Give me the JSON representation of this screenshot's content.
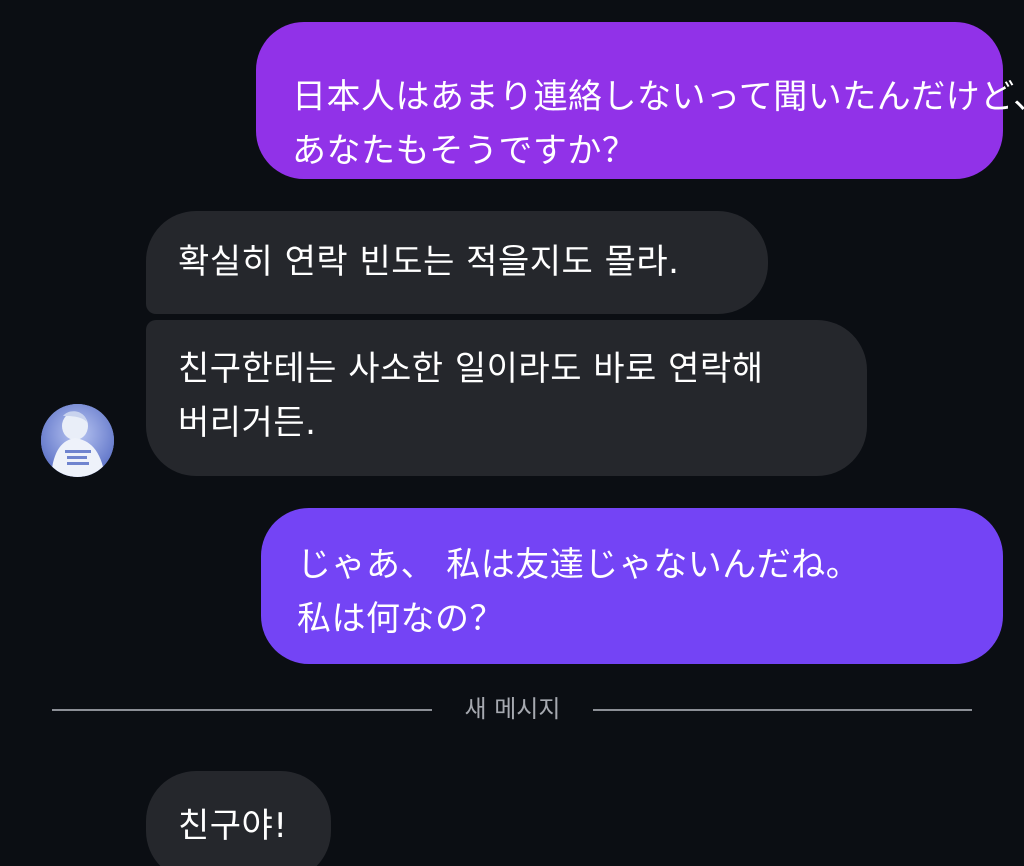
{
  "messages": [
    {
      "id": "b1",
      "direction": "sent",
      "text": "日本人はあまり連絡しないって聞いたんだけど、 あなたもそうですか？"
    },
    {
      "id": "b2",
      "direction": "received",
      "text": "확실히 연락 빈도는 적을지도 몰라."
    },
    {
      "id": "b3",
      "direction": "received",
      "text": "친구한테는 사소한 일이라도 바로 연락해 버리거든."
    },
    {
      "id": "b4",
      "direction": "sent",
      "text": "じゃあ、 私は友達じゃないんだね。 私は何なの？"
    },
    {
      "id": "b5",
      "direction": "received",
      "text": "친구야!"
    }
  ],
  "divider": {
    "label": "새 메시지"
  },
  "avatar": {
    "icon": "user-avatar"
  },
  "colors": {
    "background": "#0b0e13",
    "sent_bubble_1": "#9132e8",
    "sent_bubble_2": "#7444f5",
    "received_bubble": "#25272c",
    "divider": "#8c8f96"
  }
}
